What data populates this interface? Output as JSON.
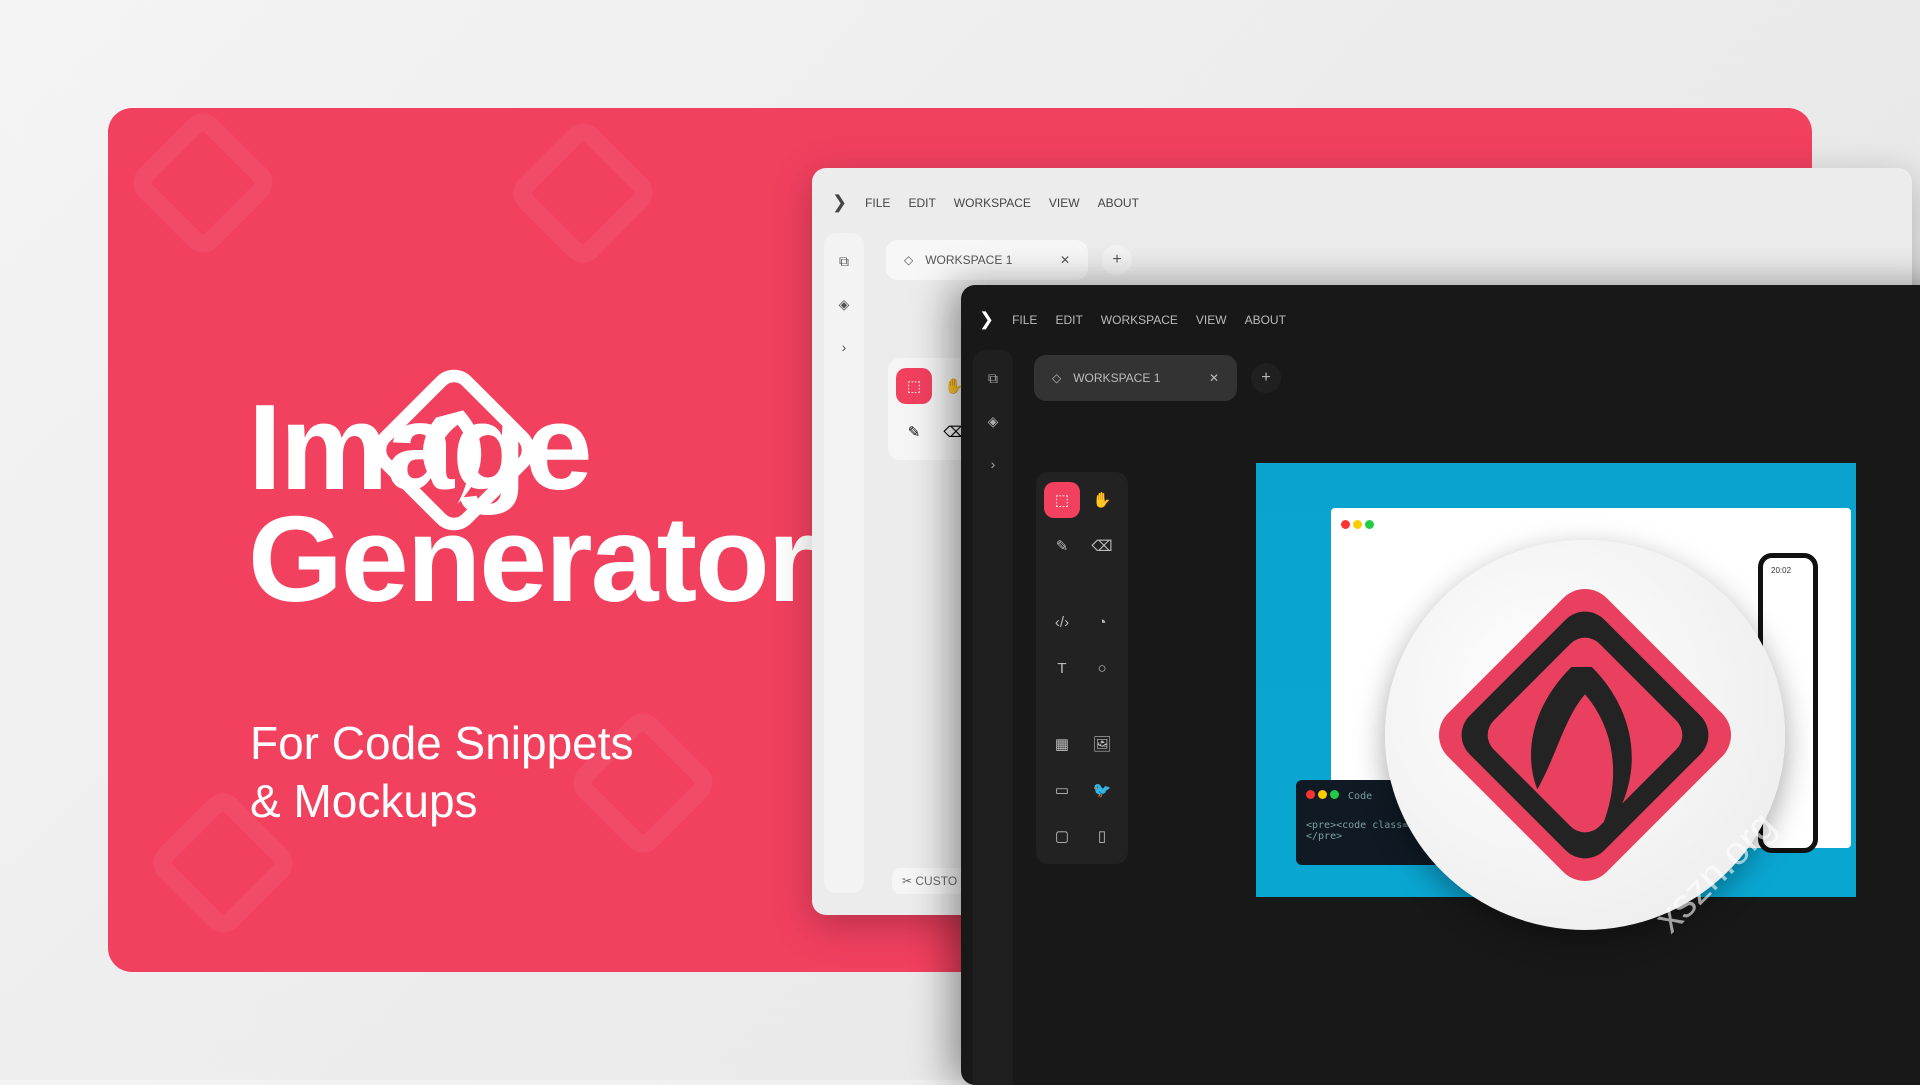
{
  "hero": {
    "title_line1": "Image",
    "title_line2": "Generator",
    "subtitle_line1": "For Code Snippets",
    "subtitle_line2": "& Mockups"
  },
  "light_window": {
    "menu": [
      "FILE",
      "EDIT",
      "WORKSPACE",
      "VIEW",
      "ABOUT"
    ],
    "tab_label": "WORKSPACE 1",
    "add_tab": "+",
    "close": "✕",
    "custom_label": "CUSTO"
  },
  "dark_window": {
    "menu": [
      "FILE",
      "EDIT",
      "WORKSPACE",
      "VIEW",
      "ABOUT"
    ],
    "tab_label": "WORKSPACE 1",
    "add_tab": "+",
    "close": "✕",
    "canvas": {
      "code_line1": "<pre><code class=",
      "code_line2": "</pre>",
      "code_tab": "Code",
      "phone_time": "20:02"
    }
  },
  "watermark": "xszn.org",
  "colors": {
    "brand": "#f2405f",
    "dark": "#181818",
    "canvas": "#0aa3cf"
  }
}
